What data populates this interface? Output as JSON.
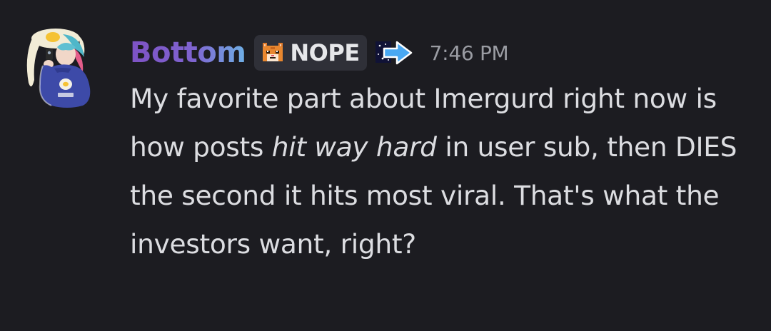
{
  "message": {
    "author": "Bottom",
    "tag_label": "NOPE",
    "timestamp": "7:46 PM",
    "text_before": "My favorite part about Imergurd right now is how posts ",
    "text_italic": "hit way hard",
    "text_after": " in user sub, then DIES the second it hits most viral. That's what the investors want, right?"
  },
  "icons": {
    "avatar": "user-avatar",
    "tag_icon": "cat-face-icon",
    "role_icon": "arrow-right-icon"
  },
  "colors": {
    "background": "#1c1c21",
    "username_start": "#7e52c4",
    "username_end": "#6fb0e6",
    "tag_background": "#2f3038",
    "timestamp": "#9a9ca3",
    "text": "#dcdde1"
  }
}
